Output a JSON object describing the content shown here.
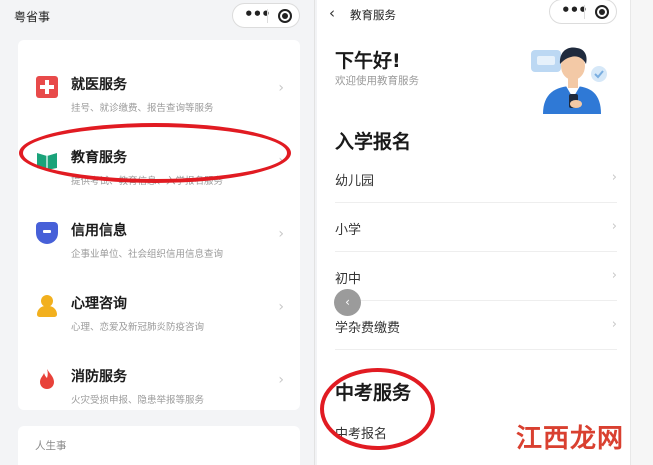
{
  "left": {
    "app_title": "粤省事",
    "services": [
      {
        "name": "就医服务",
        "desc": "挂号、就诊缴费、报告查询等服务",
        "icon": "medical-cross-icon"
      },
      {
        "name": "教育服务",
        "desc": "提供考试、教育信息、入学报名服务",
        "icon": "book-icon"
      },
      {
        "name": "信用信息",
        "desc": "企事业单位、社会组织信用信息查询",
        "icon": "shield-icon"
      },
      {
        "name": "心理咨询",
        "desc": "心理、恋爱及新冠肺炎防疫咨询",
        "icon": "person-consult-icon"
      },
      {
        "name": "消防服务",
        "desc": "火灾受损申报、隐患举报等服务",
        "icon": "flame-icon"
      }
    ],
    "life_section": "人生事"
  },
  "right": {
    "page_title": "教育服务",
    "greeting": "下午好!",
    "greeting_sub": "欢迎使用教育服务",
    "section_enroll": "入学报名",
    "enroll_items": [
      "幼儿园",
      "小学",
      "初中",
      "学杂费缴费"
    ],
    "section_exam": "中考服务",
    "exam_items": [
      "中考报名"
    ]
  },
  "watermark": "江西龙网",
  "colors": {
    "highlight": "#e11b22",
    "medical": "#e84a4a",
    "education": "#1aa37a",
    "credit": "#4760d8",
    "psych": "#f2b01e",
    "fire": "#e8423a"
  }
}
